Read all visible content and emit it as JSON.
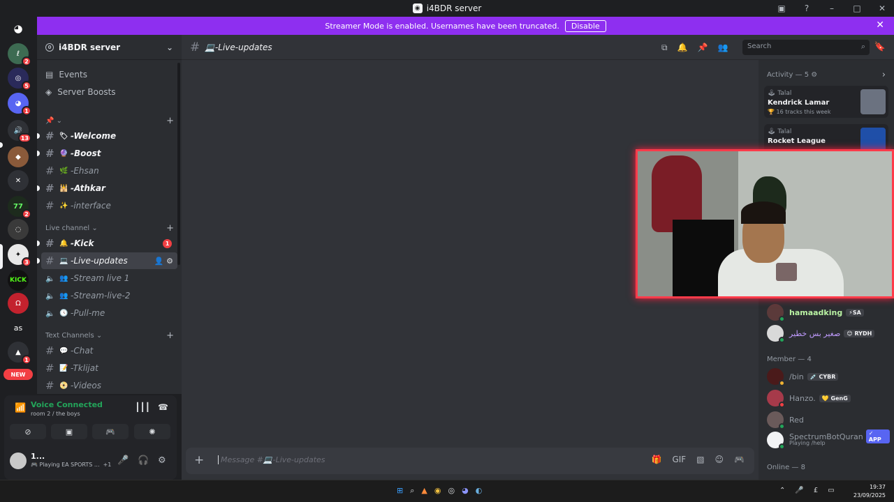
{
  "window": {
    "title": "i4BDR server"
  },
  "banner": {
    "text": "Streamer Mode is enabled. Usernames have been truncated.",
    "button": "Disable"
  },
  "rail": {
    "logo": "discord-icon",
    "badges": [
      "2",
      "5",
      "1",
      "13",
      "2",
      "3",
      "1"
    ],
    "kick_label": "KICK",
    "as_label": "as",
    "new_label": "NEW",
    "seventy_seven": "77"
  },
  "server": {
    "name": "i4BDR server"
  },
  "nav": {
    "events": "Events",
    "boosts": "Server Boosts"
  },
  "categories": {
    "pinned": "",
    "live": "Live channel",
    "text": "Text Channels"
  },
  "channels": [
    {
      "emoji": "🏷",
      "name": "-Welcome"
    },
    {
      "emoji": "🔮",
      "name": "-Boost"
    },
    {
      "emoji": "🌿",
      "name": "-Ehsan"
    },
    {
      "emoji": "🕌",
      "name": "-Athkar"
    },
    {
      "emoji": "✨",
      "name": "-interface"
    },
    {
      "emoji": "🔔",
      "name": "-Kick",
      "mentions": "1"
    },
    {
      "emoji": "💻",
      "name": "-Live-updates"
    },
    {
      "emoji": "👥",
      "name": "-Stream live 1"
    },
    {
      "emoji": "👥",
      "name": "-Stream-live-2"
    },
    {
      "emoji": "🕓",
      "name": "-Pull-me"
    },
    {
      "emoji": "💬",
      "name": "-Chat"
    },
    {
      "emoji": "📝",
      "name": "-Tklijat"
    },
    {
      "emoji": "📀",
      "name": "-Videos"
    }
  ],
  "voice": {
    "status": "Voice Connected",
    "location": "room 2 / the boys"
  },
  "user": {
    "name": "1...",
    "activity": "🎮 Playing EA SPORTS ...",
    "extra": "+1"
  },
  "header": {
    "channel": "💻-Live-updates",
    "search_placeholder": "Search"
  },
  "composer": {
    "placeholder": "Message #💻-Live-updates"
  },
  "members": {
    "activity_header": "Activity — 5",
    "activities": [
      {
        "who": "Talal",
        "game": "Kendrick Lamar",
        "meta": "🏆 16 tracks this week"
      },
      {
        "who": "Talal",
        "game": "Rocket League",
        "meta": ""
      }
    ],
    "vip": [
      {
        "name": "hamaadking",
        "tag": "⚡SA",
        "color": "#b9f2a3"
      },
      {
        "name": "صغير بس خطير",
        "tag": "😊 RYDH",
        "color": "#c19cff"
      }
    ],
    "member_header": "Member — 4",
    "member_list": [
      {
        "name": "/bin",
        "tag": "💉 CYBR"
      },
      {
        "name": "Hanzo.",
        "tag": "💛 GenG"
      },
      {
        "name": "Red",
        "tag": ""
      },
      {
        "name": "SpectrumBotQuran",
        "tag": "✓ APP",
        "sub": "Playing /help"
      }
    ],
    "online_header": "Online — 8"
  },
  "taskbar": {
    "time": "19:37",
    "date": "23/09/2025",
    "lang": "£"
  },
  "colors": {
    "accent": "#8e2ff0",
    "online": "#23a55a",
    "badge": "#f23f43",
    "blurple": "#5865f2"
  }
}
